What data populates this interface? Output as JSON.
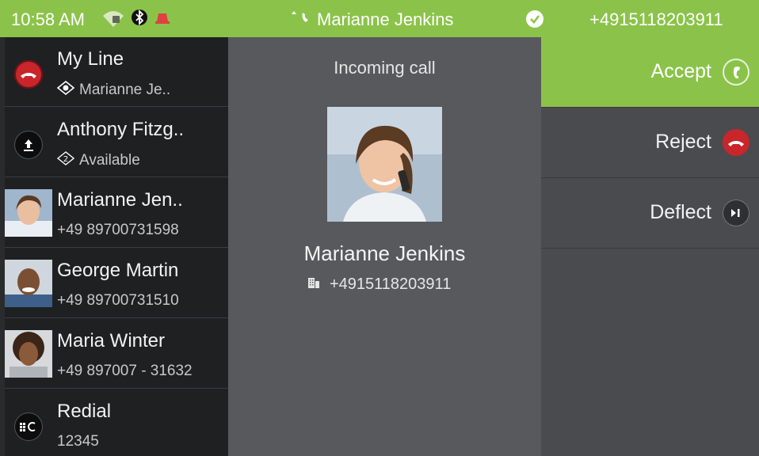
{
  "statusbar": {
    "time": "10:58 AM",
    "caller_name": "Marianne Jenkins",
    "number": "+4915118203911",
    "icons": [
      "wifi-icon",
      "lock-icon",
      "bluetooth-icon",
      "alert-bell-icon",
      "phone-transfer-icon",
      "check-icon"
    ]
  },
  "sidebar": {
    "items": [
      {
        "title": "My Line",
        "sub": "Marianne Je..",
        "icon": "hangup-icon",
        "sub_icon": "status-icon"
      },
      {
        "title": "Anthony Fitzg..",
        "sub": "Available",
        "icon": "upload-icon",
        "sub_icon": "number-2-icon"
      },
      {
        "title": "Marianne Jen..",
        "sub": "+49 89700731598",
        "icon": "avatar"
      },
      {
        "title": "George Martin",
        "sub": "+49 89700731510",
        "icon": "avatar"
      },
      {
        "title": "Maria Winter",
        "sub": "+49 897007 - 31632",
        "icon": "avatar"
      },
      {
        "title": "Redial",
        "sub": "12345",
        "icon": "redial-icon"
      }
    ]
  },
  "center": {
    "label": "Incoming call",
    "caller_name": "Marianne Jenkins",
    "caller_number": "+4915118203911"
  },
  "actions": {
    "accept": "Accept",
    "reject": "Reject",
    "deflect": "Deflect"
  },
  "colors": {
    "accent_green": "#8bc34a",
    "reject_red": "#c8262b",
    "sidebar_bg": "#1f2022",
    "center_bg": "#58595d",
    "actions_bg": "#4a4b4f"
  }
}
